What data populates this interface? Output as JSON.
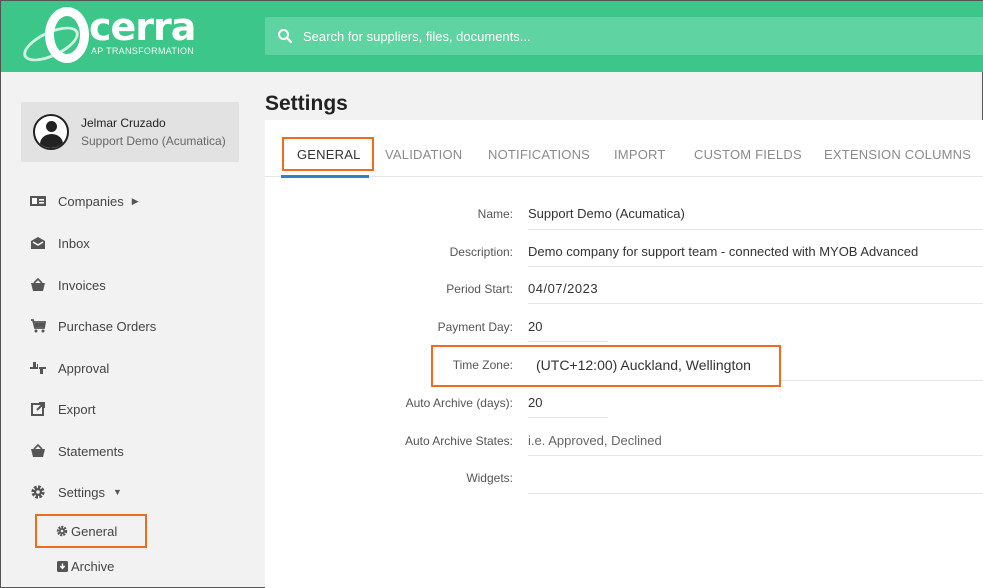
{
  "header": {
    "logo_text": "cerra",
    "logo_subtitle": "AP TRANSFORMATION",
    "search_placeholder": "Search for suppliers, files, documents..."
  },
  "user": {
    "name": "Jelmar Cruzado",
    "organization": "Support Demo (Acumatica)"
  },
  "sidebar": {
    "items": [
      {
        "label": "Companies",
        "icon": "id-card-icon",
        "has_submenu": true
      },
      {
        "label": "Inbox",
        "icon": "envelope-icon"
      },
      {
        "label": "Invoices",
        "icon": "basket-icon"
      },
      {
        "label": "Purchase Orders",
        "icon": "cart-icon"
      },
      {
        "label": "Approval",
        "icon": "thumbs-icon"
      },
      {
        "label": "Export",
        "icon": "external-link-icon"
      },
      {
        "label": "Statements",
        "icon": "basket-icon"
      },
      {
        "label": "Settings",
        "icon": "gear-icon",
        "expanded": true
      }
    ],
    "settings_sub": [
      {
        "label": "General",
        "icon": "gear-icon",
        "active": true
      },
      {
        "label": "Archive",
        "icon": "archive-icon"
      }
    ]
  },
  "page": {
    "title": "Settings",
    "tabs": [
      "GENERAL",
      "VALIDATION",
      "NOTIFICATIONS",
      "IMPORT",
      "CUSTOM FIELDS",
      "EXTENSION COLUMNS"
    ],
    "active_tab": "GENERAL",
    "fields": [
      {
        "label": "Name:",
        "value": "Support Demo (Acumatica)"
      },
      {
        "label": "Description:",
        "value": "Demo company for support team - connected with MYOB Advanced"
      },
      {
        "label": "Period Start:",
        "value": "04/07/2023"
      },
      {
        "label": "Payment Day:",
        "value": "20"
      },
      {
        "label": "Time Zone:",
        "value": "(UTC+12:00) Auckland, Wellington"
      },
      {
        "label": "Auto Archive (days):",
        "value": "20"
      },
      {
        "label": "Auto Archive States:",
        "value": "i.e. Approved, Declined"
      },
      {
        "label": "Widgets:",
        "value": ""
      }
    ]
  },
  "colors": {
    "brand_green": "#3cc68a",
    "search_bg": "#5fd3a1",
    "highlight": "#ef6c1f",
    "tab_underline": "#2f80c8"
  }
}
